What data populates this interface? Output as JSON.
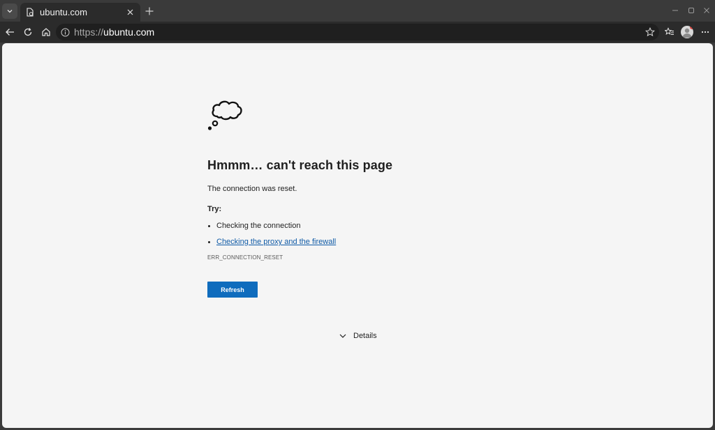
{
  "tab": {
    "title": "ubuntu.com"
  },
  "omnibox": {
    "scheme": "https://",
    "host": "ubuntu.com"
  },
  "page": {
    "title": "Hmmm… can't reach this page",
    "description": "The connection was reset.",
    "try_label": "Try:",
    "suggestions": [
      {
        "text": "Checking the connection",
        "link": false
      },
      {
        "text": "Checking the proxy and the firewall",
        "link": true
      }
    ],
    "error_code": "ERR_CONNECTION_RESET",
    "refresh_label": "Refresh",
    "details_label": "Details"
  },
  "colors": {
    "accent": "#0f6cbd",
    "link": "#0f5aa6",
    "page_bg": "#f5f5f5",
    "chrome_bg": "#2b2b2b"
  },
  "icons": [
    "tab-actions-icon",
    "shield-doc-icon",
    "close-icon",
    "plus-icon",
    "minimize-icon",
    "maximize-icon",
    "window-close-icon",
    "back-arrow-icon",
    "refresh-icon",
    "home-icon",
    "info-icon",
    "star-icon",
    "favorites-icon",
    "profile-avatar",
    "more-icon",
    "cloud-icon",
    "chevron-down-icon"
  ]
}
